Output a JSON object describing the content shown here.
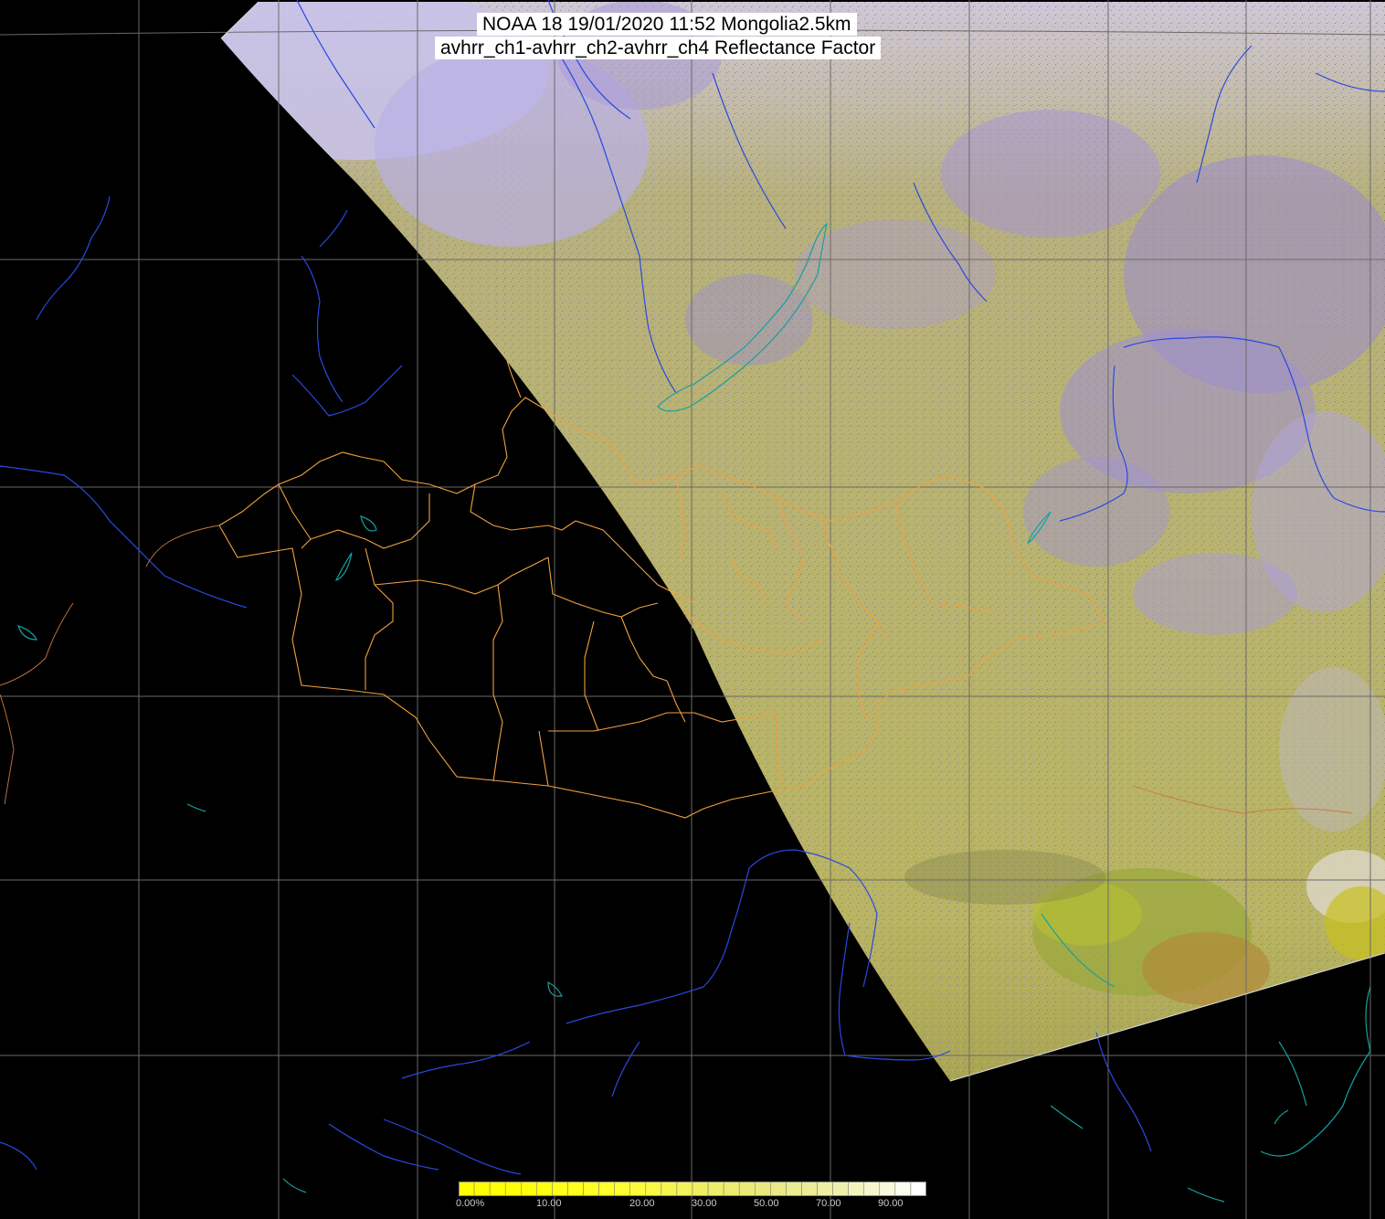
{
  "title": {
    "line1": "NOAA 18 19/01/2020 11:52 Mongolia2.5km",
    "line2": "avhrr_ch1-avhrr_ch2-avhrr_ch4 Reflectance Factor"
  },
  "colorbar": {
    "ticks": [
      "0.00%",
      "10.00",
      "20.00",
      "30.00",
      "50.00",
      "70.00",
      "90.00"
    ],
    "colors": [
      "#ffff00",
      "#ffff10",
      "#ffff30",
      "#f0f060",
      "#e8e880",
      "#f0f0b0",
      "#ffffff"
    ]
  },
  "colors": {
    "background": "#000000",
    "swath_base": "#b4b064",
    "cloud": "#a89adc",
    "grid": "#6a6a6a",
    "rivers": "#2244dd",
    "lakes": "#16a0a0",
    "admin_borders": "#f0a040",
    "frame": "#ffffff"
  },
  "icons": {
    "legend": "colorbar-gradient"
  }
}
